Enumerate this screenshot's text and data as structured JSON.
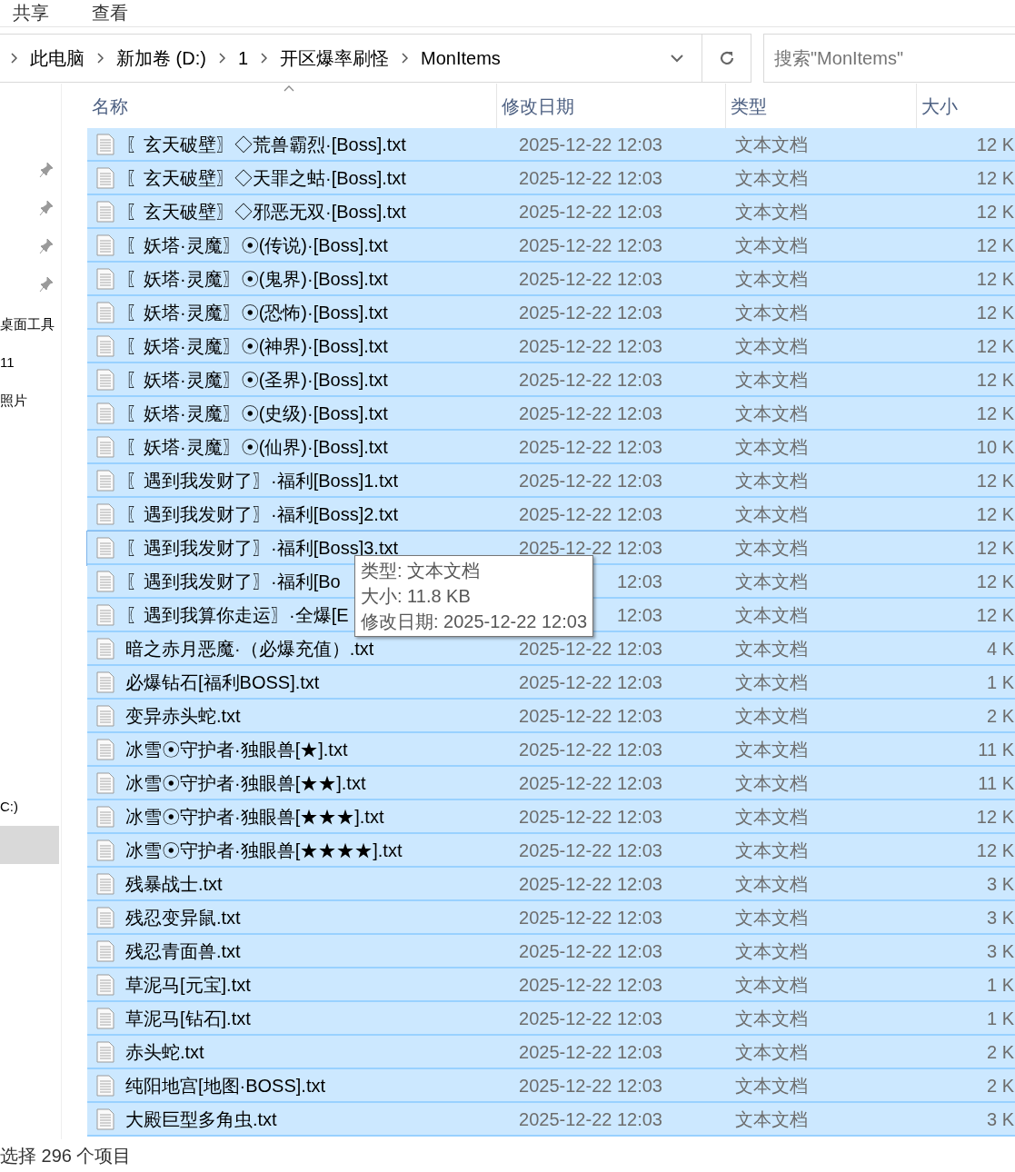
{
  "ribbon_tabs": [
    {
      "label": "共享"
    },
    {
      "label": "查看"
    }
  ],
  "breadcrumbs": [
    "此电脑",
    "新加卷 (D:)",
    "1",
    "开区爆率刷怪",
    "MonItems"
  ],
  "search": {
    "placeholder": "搜索\"MonItems\""
  },
  "nav_items": [
    {
      "label": "桌面工具",
      "selected": false
    },
    {
      "label": "11",
      "selected": false
    },
    {
      "label": "照片",
      "selected": false
    },
    {
      "label": "C:)",
      "selected": false
    },
    {
      "selected": true
    }
  ],
  "table": {
    "columns": [
      {
        "label": "名称",
        "sorted": true
      },
      {
        "label": "修改日期",
        "sorted": false
      },
      {
        "label": "类型",
        "sorted": false
      },
      {
        "label": "大小",
        "sorted": false
      }
    ],
    "rows": [
      {
        "name": "〖玄天破壁〗◇荒兽霸烈·[Boss].txt",
        "date": "2025-12-22 12:03",
        "type": "文本文档",
        "size": "12 K",
        "selected": true,
        "hovered": false
      },
      {
        "name": "〖玄天破壁〗◇天罪之蛄·[Boss].txt",
        "date": "2025-12-22 12:03",
        "type": "文本文档",
        "size": "12 K",
        "selected": true,
        "hovered": false
      },
      {
        "name": "〖玄天破壁〗◇邪恶无双·[Boss].txt",
        "date": "2025-12-22 12:03",
        "type": "文本文档",
        "size": "12 K",
        "selected": true,
        "hovered": false
      },
      {
        "name": "〖妖塔·灵魔〗☉(传说)·[Boss].txt",
        "date": "2025-12-22 12:03",
        "type": "文本文档",
        "size": "12 K",
        "selected": true,
        "hovered": false
      },
      {
        "name": "〖妖塔·灵魔〗☉(鬼界)·[Boss].txt",
        "date": "2025-12-22 12:03",
        "type": "文本文档",
        "size": "12 K",
        "selected": true,
        "hovered": false
      },
      {
        "name": "〖妖塔·灵魔〗☉(恐怖)·[Boss].txt",
        "date": "2025-12-22 12:03",
        "type": "文本文档",
        "size": "12 K",
        "selected": true,
        "hovered": false
      },
      {
        "name": "〖妖塔·灵魔〗☉(神界)·[Boss].txt",
        "date": "2025-12-22 12:03",
        "type": "文本文档",
        "size": "12 K",
        "selected": true,
        "hovered": false
      },
      {
        "name": "〖妖塔·灵魔〗☉(圣界)·[Boss].txt",
        "date": "2025-12-22 12:03",
        "type": "文本文档",
        "size": "12 K",
        "selected": true,
        "hovered": false
      },
      {
        "name": "〖妖塔·灵魔〗☉(史级)·[Boss].txt",
        "date": "2025-12-22 12:03",
        "type": "文本文档",
        "size": "12 K",
        "selected": true,
        "hovered": false
      },
      {
        "name": "〖妖塔·灵魔〗☉(仙界)·[Boss].txt",
        "date": "2025-12-22 12:03",
        "type": "文本文档",
        "size": "10 K",
        "selected": true,
        "hovered": false
      },
      {
        "name": "〖遇到我发财了〗·福利[Boss]1.txt",
        "date": "2025-12-22 12:03",
        "type": "文本文档",
        "size": "12 K",
        "selected": true,
        "hovered": false
      },
      {
        "name": "〖遇到我发财了〗·福利[Boss]2.txt",
        "date": "2025-12-22 12:03",
        "type": "文本文档",
        "size": "12 K",
        "selected": true,
        "hovered": false
      },
      {
        "name": "〖遇到我发财了〗·福利[Boss]3.txt",
        "date": "2025-12-22 12:03",
        "type": "文本文档",
        "size": "12 K",
        "selected": true,
        "hovered": true
      },
      {
        "name": "〖遇到我发财了〗·福利[Bo",
        "date": "12:03",
        "type": "文本文档",
        "size": "12 K",
        "selected": true,
        "hovered": false
      },
      {
        "name": "〖遇到我算你走运〗·全爆[E",
        "date": "12:03",
        "type": "文本文档",
        "size": "12 K",
        "selected": true,
        "hovered": false
      },
      {
        "name": "暗之赤月恶魔·（必爆充值）.txt",
        "date": "2025-12-22 12:03",
        "type": "文本文档",
        "size": "4 K",
        "selected": true,
        "hovered": false
      },
      {
        "name": "必爆钻石[福利BOSS].txt",
        "date": "2025-12-22 12:03",
        "type": "文本文档",
        "size": "1 K",
        "selected": true,
        "hovered": false
      },
      {
        "name": "变异赤头蛇.txt",
        "date": "2025-12-22 12:03",
        "type": "文本文档",
        "size": "2 K",
        "selected": true,
        "hovered": false
      },
      {
        "name": "冰雪☉守护者·独眼兽[★].txt",
        "date": "2025-12-22 12:03",
        "type": "文本文档",
        "size": "11 K",
        "selected": true,
        "hovered": false
      },
      {
        "name": "冰雪☉守护者·独眼兽[★★].txt",
        "date": "2025-12-22 12:03",
        "type": "文本文档",
        "size": "11 K",
        "selected": true,
        "hovered": false
      },
      {
        "name": "冰雪☉守护者·独眼兽[★★★].txt",
        "date": "2025-12-22 12:03",
        "type": "文本文档",
        "size": "12 K",
        "selected": true,
        "hovered": false
      },
      {
        "name": "冰雪☉守护者·独眼兽[★★★★].txt",
        "date": "2025-12-22 12:03",
        "type": "文本文档",
        "size": "12 K",
        "selected": true,
        "hovered": false
      },
      {
        "name": "残暴战士.txt",
        "date": "2025-12-22 12:03",
        "type": "文本文档",
        "size": "3 K",
        "selected": true,
        "hovered": false
      },
      {
        "name": "残忍变异鼠.txt",
        "date": "2025-12-22 12:03",
        "type": "文本文档",
        "size": "3 K",
        "selected": true,
        "hovered": false
      },
      {
        "name": "残忍青面兽.txt",
        "date": "2025-12-22 12:03",
        "type": "文本文档",
        "size": "3 K",
        "selected": true,
        "hovered": false
      },
      {
        "name": "草泥马[元宝].txt",
        "date": "2025-12-22 12:03",
        "type": "文本文档",
        "size": "1 K",
        "selected": true,
        "hovered": false
      },
      {
        "name": "草泥马[钻石].txt",
        "date": "2025-12-22 12:03",
        "type": "文本文档",
        "size": "1 K",
        "selected": true,
        "hovered": false
      },
      {
        "name": "赤头蛇.txt",
        "date": "2025-12-22 12:03",
        "type": "文本文档",
        "size": "2 K",
        "selected": true,
        "hovered": false
      },
      {
        "name": "纯阳地宫[地图·BOSS].txt",
        "date": "2025-12-22 12:03",
        "type": "文本文档",
        "size": "2 K",
        "selected": true,
        "hovered": false
      },
      {
        "name": "大殿巨型多角虫.txt",
        "date": "2025-12-22 12:03",
        "type": "文本文档",
        "size": "3 K",
        "selected": true,
        "hovered": false
      }
    ]
  },
  "tooltip": {
    "lines": [
      "类型: 文本文档",
      "大小: 11.8 KB",
      "修改日期: 2025-12-22 12:03"
    ]
  },
  "status_bar": {
    "text": "选择 296 个项目"
  }
}
